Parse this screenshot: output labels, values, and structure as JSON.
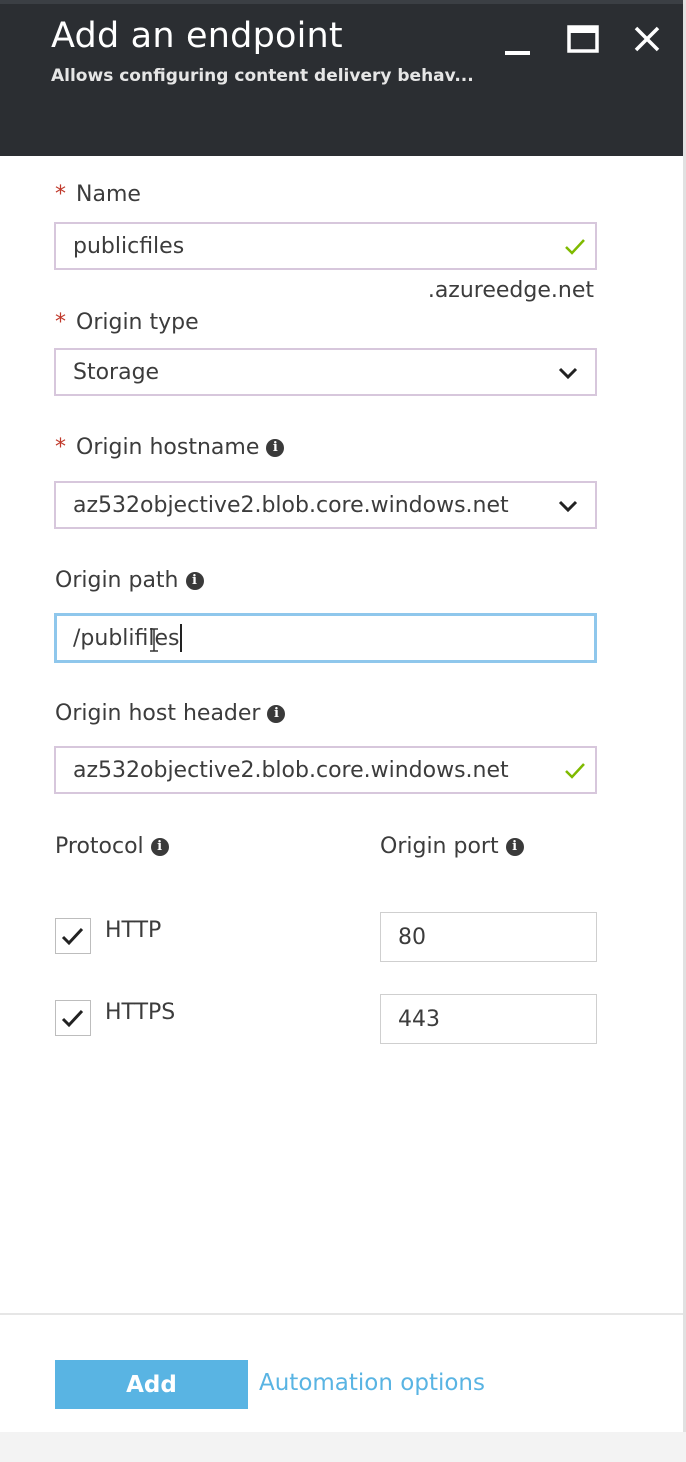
{
  "header": {
    "title": "Add an endpoint",
    "subtitle": "Allows configuring content delivery behav..."
  },
  "window_controls": [
    "minimize-icon",
    "maximize-icon",
    "close-icon"
  ],
  "form": {
    "name": {
      "label": "Name",
      "required": true,
      "value": "publicfiles",
      "suffix": ".azureedge.net",
      "valid": true
    },
    "origin_type": {
      "label": "Origin type",
      "required": true,
      "value": "Storage"
    },
    "origin_hostname": {
      "label": "Origin hostname",
      "required": true,
      "value": "az532objective2.blob.core.windows.net"
    },
    "origin_path": {
      "label": "Origin path",
      "value_before_cursor": "/publi",
      "value_after_cursor": "files",
      "value": "/publicfiles"
    },
    "origin_host_header": {
      "label": "Origin host header",
      "value": "az532objective2.blob.core.windows.net",
      "valid": true
    },
    "protocol": {
      "label": "Protocol",
      "options": [
        {
          "label": "HTTP",
          "checked": true
        },
        {
          "label": "HTTPS",
          "checked": true
        }
      ]
    },
    "origin_port": {
      "label": "Origin port",
      "http_port": "80",
      "https_port": "443"
    }
  },
  "footer": {
    "add_label": "Add",
    "automation_label": "Automation options"
  },
  "colors": {
    "header_bg": "#2b2e32",
    "accent": "#59b4e3",
    "required": "#c0392b",
    "valid_check": "#7fba00",
    "focus_border": "#8fc7ec"
  }
}
